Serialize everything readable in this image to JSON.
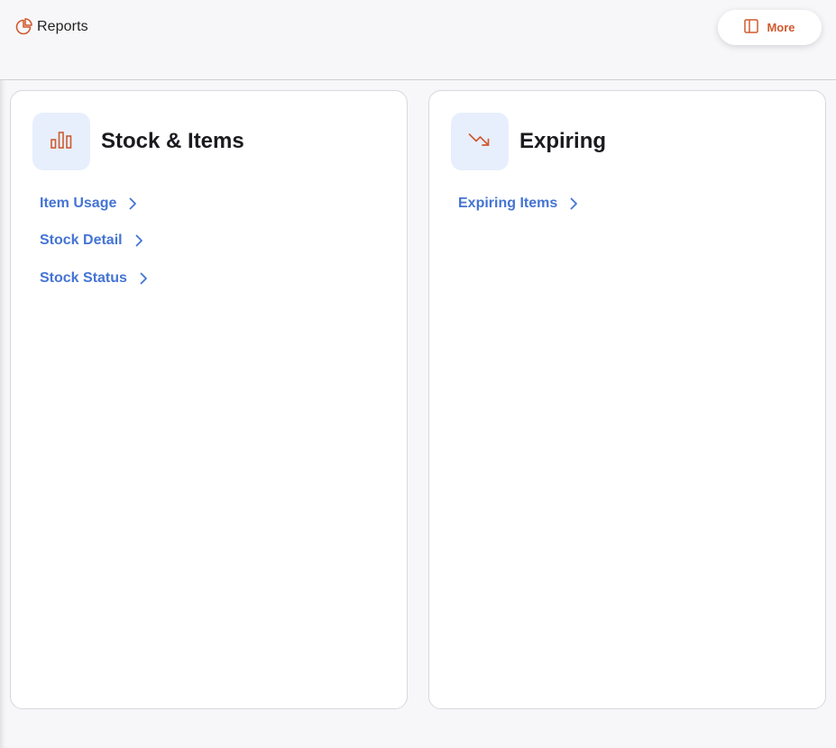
{
  "header": {
    "title": "Reports",
    "title_icon": "pie-chart-icon",
    "more_button": {
      "label": "More",
      "icon": "panel-icon"
    }
  },
  "colors": {
    "accent": "#d05a30",
    "link": "#4474d4",
    "icon_bg": "#e7effd"
  },
  "cards": [
    {
      "title": "Stock & Items",
      "icon": "bar-chart-icon",
      "links": [
        {
          "label": "Item Usage"
        },
        {
          "label": "Stock Detail"
        },
        {
          "label": "Stock Status"
        }
      ]
    },
    {
      "title": "Expiring",
      "icon": "trend-down-icon",
      "links": [
        {
          "label": "Expiring Items"
        }
      ]
    }
  ]
}
